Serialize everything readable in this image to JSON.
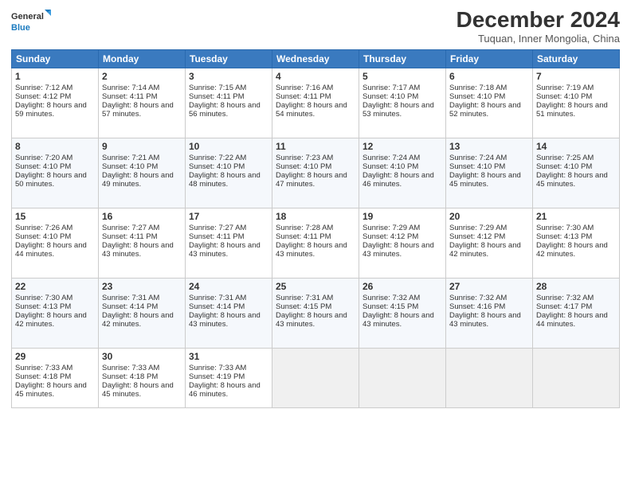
{
  "header": {
    "logo_general": "General",
    "logo_blue": "Blue",
    "title": "December 2024",
    "subtitle": "Tuquan, Inner Mongolia, China"
  },
  "weekdays": [
    "Sunday",
    "Monday",
    "Tuesday",
    "Wednesday",
    "Thursday",
    "Friday",
    "Saturday"
  ],
  "weeks": [
    [
      {
        "day": "1",
        "sunrise": "Sunrise: 7:12 AM",
        "sunset": "Sunset: 4:12 PM",
        "daylight": "Daylight: 8 hours and 59 minutes."
      },
      {
        "day": "2",
        "sunrise": "Sunrise: 7:14 AM",
        "sunset": "Sunset: 4:11 PM",
        "daylight": "Daylight: 8 hours and 57 minutes."
      },
      {
        "day": "3",
        "sunrise": "Sunrise: 7:15 AM",
        "sunset": "Sunset: 4:11 PM",
        "daylight": "Daylight: 8 hours and 56 minutes."
      },
      {
        "day": "4",
        "sunrise": "Sunrise: 7:16 AM",
        "sunset": "Sunset: 4:11 PM",
        "daylight": "Daylight: 8 hours and 54 minutes."
      },
      {
        "day": "5",
        "sunrise": "Sunrise: 7:17 AM",
        "sunset": "Sunset: 4:10 PM",
        "daylight": "Daylight: 8 hours and 53 minutes."
      },
      {
        "day": "6",
        "sunrise": "Sunrise: 7:18 AM",
        "sunset": "Sunset: 4:10 PM",
        "daylight": "Daylight: 8 hours and 52 minutes."
      },
      {
        "day": "7",
        "sunrise": "Sunrise: 7:19 AM",
        "sunset": "Sunset: 4:10 PM",
        "daylight": "Daylight: 8 hours and 51 minutes."
      }
    ],
    [
      {
        "day": "8",
        "sunrise": "Sunrise: 7:20 AM",
        "sunset": "Sunset: 4:10 PM",
        "daylight": "Daylight: 8 hours and 50 minutes."
      },
      {
        "day": "9",
        "sunrise": "Sunrise: 7:21 AM",
        "sunset": "Sunset: 4:10 PM",
        "daylight": "Daylight: 8 hours and 49 minutes."
      },
      {
        "day": "10",
        "sunrise": "Sunrise: 7:22 AM",
        "sunset": "Sunset: 4:10 PM",
        "daylight": "Daylight: 8 hours and 48 minutes."
      },
      {
        "day": "11",
        "sunrise": "Sunrise: 7:23 AM",
        "sunset": "Sunset: 4:10 PM",
        "daylight": "Daylight: 8 hours and 47 minutes."
      },
      {
        "day": "12",
        "sunrise": "Sunrise: 7:24 AM",
        "sunset": "Sunset: 4:10 PM",
        "daylight": "Daylight: 8 hours and 46 minutes."
      },
      {
        "day": "13",
        "sunrise": "Sunrise: 7:24 AM",
        "sunset": "Sunset: 4:10 PM",
        "daylight": "Daylight: 8 hours and 45 minutes."
      },
      {
        "day": "14",
        "sunrise": "Sunrise: 7:25 AM",
        "sunset": "Sunset: 4:10 PM",
        "daylight": "Daylight: 8 hours and 45 minutes."
      }
    ],
    [
      {
        "day": "15",
        "sunrise": "Sunrise: 7:26 AM",
        "sunset": "Sunset: 4:10 PM",
        "daylight": "Daylight: 8 hours and 44 minutes."
      },
      {
        "day": "16",
        "sunrise": "Sunrise: 7:27 AM",
        "sunset": "Sunset: 4:11 PM",
        "daylight": "Daylight: 8 hours and 43 minutes."
      },
      {
        "day": "17",
        "sunrise": "Sunrise: 7:27 AM",
        "sunset": "Sunset: 4:11 PM",
        "daylight": "Daylight: 8 hours and 43 minutes."
      },
      {
        "day": "18",
        "sunrise": "Sunrise: 7:28 AM",
        "sunset": "Sunset: 4:11 PM",
        "daylight": "Daylight: 8 hours and 43 minutes."
      },
      {
        "day": "19",
        "sunrise": "Sunrise: 7:29 AM",
        "sunset": "Sunset: 4:12 PM",
        "daylight": "Daylight: 8 hours and 43 minutes."
      },
      {
        "day": "20",
        "sunrise": "Sunrise: 7:29 AM",
        "sunset": "Sunset: 4:12 PM",
        "daylight": "Daylight: 8 hours and 42 minutes."
      },
      {
        "day": "21",
        "sunrise": "Sunrise: 7:30 AM",
        "sunset": "Sunset: 4:13 PM",
        "daylight": "Daylight: 8 hours and 42 minutes."
      }
    ],
    [
      {
        "day": "22",
        "sunrise": "Sunrise: 7:30 AM",
        "sunset": "Sunset: 4:13 PM",
        "daylight": "Daylight: 8 hours and 42 minutes."
      },
      {
        "day": "23",
        "sunrise": "Sunrise: 7:31 AM",
        "sunset": "Sunset: 4:14 PM",
        "daylight": "Daylight: 8 hours and 42 minutes."
      },
      {
        "day": "24",
        "sunrise": "Sunrise: 7:31 AM",
        "sunset": "Sunset: 4:14 PM",
        "daylight": "Daylight: 8 hours and 43 minutes."
      },
      {
        "day": "25",
        "sunrise": "Sunrise: 7:31 AM",
        "sunset": "Sunset: 4:15 PM",
        "daylight": "Daylight: 8 hours and 43 minutes."
      },
      {
        "day": "26",
        "sunrise": "Sunrise: 7:32 AM",
        "sunset": "Sunset: 4:15 PM",
        "daylight": "Daylight: 8 hours and 43 minutes."
      },
      {
        "day": "27",
        "sunrise": "Sunrise: 7:32 AM",
        "sunset": "Sunset: 4:16 PM",
        "daylight": "Daylight: 8 hours and 43 minutes."
      },
      {
        "day": "28",
        "sunrise": "Sunrise: 7:32 AM",
        "sunset": "Sunset: 4:17 PM",
        "daylight": "Daylight: 8 hours and 44 minutes."
      }
    ],
    [
      {
        "day": "29",
        "sunrise": "Sunrise: 7:33 AM",
        "sunset": "Sunset: 4:18 PM",
        "daylight": "Daylight: 8 hours and 45 minutes."
      },
      {
        "day": "30",
        "sunrise": "Sunrise: 7:33 AM",
        "sunset": "Sunset: 4:18 PM",
        "daylight": "Daylight: 8 hours and 45 minutes."
      },
      {
        "day": "31",
        "sunrise": "Sunrise: 7:33 AM",
        "sunset": "Sunset: 4:19 PM",
        "daylight": "Daylight: 8 hours and 46 minutes."
      },
      null,
      null,
      null,
      null
    ]
  ]
}
